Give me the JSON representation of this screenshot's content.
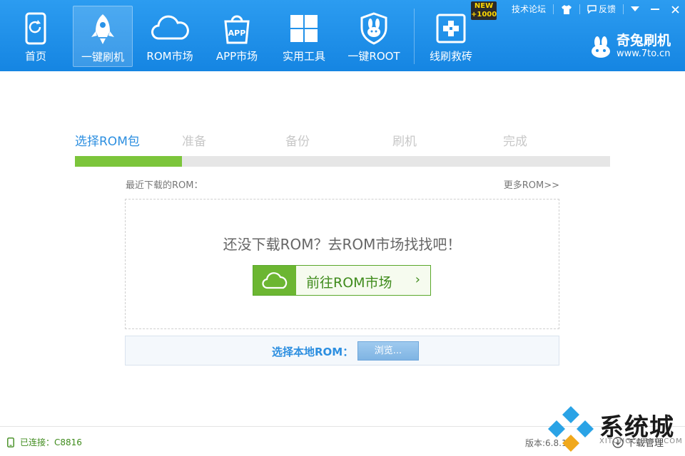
{
  "nav": {
    "items": [
      {
        "label": "首页",
        "icon": "phone-refresh-icon"
      },
      {
        "label": "一键刷机",
        "icon": "rocket-icon",
        "active": true
      },
      {
        "label": "ROM市场",
        "icon": "cloud-icon"
      },
      {
        "label": "APP市场",
        "icon": "app-bag-icon"
      },
      {
        "label": "实用工具",
        "icon": "windows-grid-icon"
      },
      {
        "label": "一键ROOT",
        "icon": "rabbit-shield-icon"
      },
      {
        "label": "线刷救砖",
        "icon": "rescue-cross-icon"
      }
    ]
  },
  "top": {
    "new_badge": "NEW\n+1000",
    "forum": "技术论坛",
    "feedback": "反馈",
    "brand_name": "奇兔刷机",
    "brand_url": "www.7to.cn"
  },
  "steps": {
    "items": [
      "选择ROM包",
      "准备",
      "备份",
      "刷机",
      "完成"
    ],
    "current_index": 0,
    "progress_fraction": 0.2
  },
  "rom": {
    "recent_label": "最近下载的ROM：",
    "more_link": "更多ROM>>",
    "empty_message": "还没下载ROM？去ROM市场找找吧！",
    "go_market_label": "前往ROM市场",
    "go_market_arrow": "›",
    "local_label": "选择本地ROM：",
    "browse_label": "浏览..."
  },
  "status": {
    "connection": "已连接：C8816",
    "version": "版本:6.8.1",
    "download_manager": "下载管理"
  },
  "watermark": {
    "text": "系统城",
    "sub": "XITONGCHENG.COM"
  },
  "colors": {
    "topbar": "#1d8fea",
    "accent_green": "#6cb632",
    "step_active": "#2d8fe0"
  }
}
